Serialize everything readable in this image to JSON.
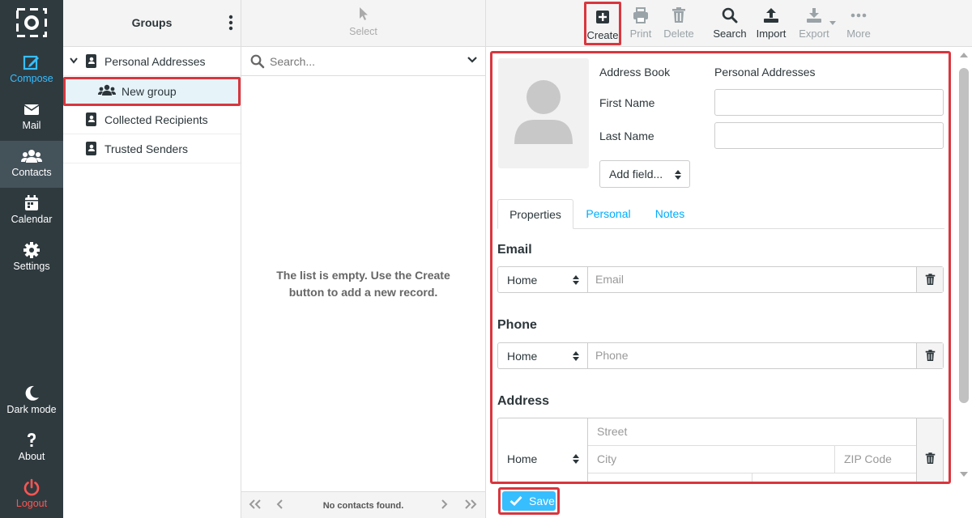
{
  "nav": {
    "compose": "Compose",
    "mail": "Mail",
    "contacts": "Contacts",
    "calendar": "Calendar",
    "settings": "Settings",
    "dark_mode": "Dark mode",
    "about": "About",
    "logout": "Logout"
  },
  "groups": {
    "title": "Groups",
    "items": [
      {
        "label": "Personal Addresses"
      },
      {
        "label": "New group"
      },
      {
        "label": "Collected Recipients"
      },
      {
        "label": "Trusted Senders"
      }
    ]
  },
  "list": {
    "select_label": "Select",
    "search_placeholder": "Search...",
    "empty_message": "The list is empty. Use the Create button to add a new record.",
    "status": "No contacts found."
  },
  "toolbar": {
    "create": "Create",
    "print": "Print",
    "delete": "Delete",
    "search": "Search",
    "import": "Import",
    "export": "Export",
    "more": "More"
  },
  "form": {
    "address_book_label": "Address Book",
    "address_book_value": "Personal Addresses",
    "first_name_label": "First Name",
    "first_name_value": "",
    "last_name_label": "Last Name",
    "last_name_value": "",
    "add_field": "Add field...",
    "tabs": [
      "Properties",
      "Personal",
      "Notes"
    ],
    "email_title": "Email",
    "email_type": "Home",
    "email_placeholder": "Email",
    "phone_title": "Phone",
    "phone_type": "Home",
    "phone_placeholder": "Phone",
    "address_title": "Address",
    "address_type": "Home",
    "street_placeholder": "Street",
    "city_placeholder": "City",
    "zip_placeholder": "ZIP Code",
    "save": "Save"
  },
  "colors": {
    "nav_bg": "#2f3a3f",
    "accent": "#37beff",
    "highlight_border": "#d9363e",
    "logout": "#ff5552"
  }
}
